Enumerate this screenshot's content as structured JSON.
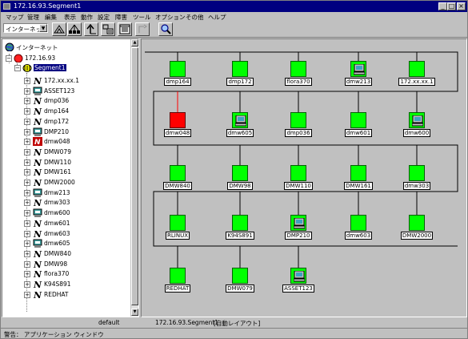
{
  "window": {
    "title": "172.16.93.Segment1",
    "btn_min": "_",
    "btn_max": "□",
    "btn_close": "×"
  },
  "menu": [
    "マップ",
    "管理",
    "編集",
    "表示",
    "動作",
    "設定",
    "障害",
    "ツール",
    "オプション",
    "その他",
    "ヘルプ"
  ],
  "toolbar": {
    "view_select": "インターネット",
    "buttons": [
      "home-icon",
      "network-icon",
      "up-level-icon",
      "submap-icon",
      "window-icon",
      "disabled-tool-icon",
      "zoom-icon"
    ]
  },
  "tree": {
    "root": "インターネット",
    "network": "172.16.93",
    "segment": "Segment1",
    "items": [
      {
        "label": "172.xx.xx.1",
        "type": "node"
      },
      {
        "label": "ASSET123",
        "type": "pc"
      },
      {
        "label": "dmp036",
        "type": "node"
      },
      {
        "label": "dmp164",
        "type": "node"
      },
      {
        "label": "dmp172",
        "type": "node"
      },
      {
        "label": "DMP210",
        "type": "pc"
      },
      {
        "label": "dmw048",
        "type": "node-down"
      },
      {
        "label": "DMW079",
        "type": "node"
      },
      {
        "label": "DMW110",
        "type": "node"
      },
      {
        "label": "DMW161",
        "type": "node"
      },
      {
        "label": "DMW2000",
        "type": "node"
      },
      {
        "label": "dmw213",
        "type": "pc"
      },
      {
        "label": "dmw303",
        "type": "node"
      },
      {
        "label": "dmw600",
        "type": "pc"
      },
      {
        "label": "dmw601",
        "type": "node"
      },
      {
        "label": "dmw603",
        "type": "node"
      },
      {
        "label": "dmw605",
        "type": "pc"
      },
      {
        "label": "DMW840",
        "type": "node"
      },
      {
        "label": "DMW98",
        "type": "node"
      },
      {
        "label": "flora370",
        "type": "node"
      },
      {
        "label": "K94S891",
        "type": "node"
      },
      {
        "label": "REDHAT",
        "type": "node"
      }
    ]
  },
  "map": {
    "rows": [
      [
        {
          "label": "dmp164",
          "status": "up",
          "icon": "box"
        },
        {
          "label": "dmp172",
          "status": "up",
          "icon": "box"
        },
        {
          "label": "flora370",
          "status": "up",
          "icon": "box"
        },
        {
          "label": "dmw213",
          "status": "up",
          "icon": "pc"
        },
        {
          "label": "172.xx.xx.1",
          "status": "up",
          "icon": "box"
        }
      ],
      [
        {
          "label": "dmw048",
          "status": "down",
          "icon": "box"
        },
        {
          "label": "dmw605",
          "status": "up",
          "icon": "pc"
        },
        {
          "label": "dmp036",
          "status": "up",
          "icon": "box"
        },
        {
          "label": "dmw601",
          "status": "up",
          "icon": "box"
        },
        {
          "label": "dmw600",
          "status": "up",
          "icon": "pc"
        }
      ],
      [
        {
          "label": "DMW840",
          "status": "up",
          "icon": "box"
        },
        {
          "label": "DMW98",
          "status": "up",
          "icon": "box"
        },
        {
          "label": "DMW110",
          "status": "up",
          "icon": "box"
        },
        {
          "label": "DMW161",
          "status": "up",
          "icon": "box"
        },
        {
          "label": "dmw303",
          "status": "up",
          "icon": "box"
        }
      ],
      [
        {
          "label": "RLINUX",
          "status": "up",
          "icon": "box"
        },
        {
          "label": "K94S891",
          "status": "up",
          "icon": "box"
        },
        {
          "label": "DMP210",
          "status": "up",
          "icon": "pc"
        },
        {
          "label": "dmw603",
          "status": "up",
          "icon": "box"
        },
        {
          "label": "DMW2000",
          "status": "up",
          "icon": "box"
        }
      ],
      [
        {
          "label": "REDHAT",
          "status": "up",
          "icon": "box"
        },
        {
          "label": "DMW079",
          "status": "up",
          "icon": "box"
        },
        {
          "label": "ASSET123",
          "status": "up",
          "icon": "pc"
        }
      ]
    ],
    "colors": {
      "up": "#00ff00",
      "down": "#ff0000",
      "background": "#c0c0c0"
    }
  },
  "status": {
    "profile": "default",
    "location": "172.16.93.Segment1",
    "mode": "[自動レイアウト]"
  },
  "warning": "警告： アプリケーション ウィンドウ"
}
